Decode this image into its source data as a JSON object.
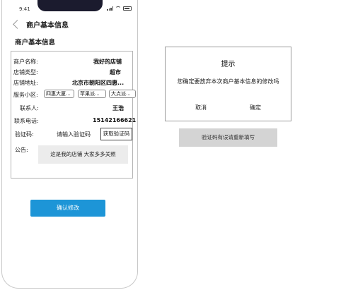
{
  "status_bar": {
    "time": "9:41"
  },
  "header": {
    "title": "商户基本信息"
  },
  "section": {
    "title": "商户基本信息"
  },
  "form": {
    "merchant_name_label": "商户名称:",
    "merchant_name_value": "我好的店铺",
    "store_type_label": "店铺类型:",
    "store_type_value": "超市",
    "store_address_label": "店铺地址:",
    "store_address_value": "北京市朝阳区四惠...",
    "service_area_label": "服务小区:",
    "service_areas": [
      "四惠大厦...",
      "苹果派...",
      "大点派..."
    ],
    "contact_label": "联系人:",
    "contact_value": "王浩",
    "phone_label": "联系电话:",
    "phone_value": "15142166621",
    "code_label": "验证码:",
    "code_placeholder": "请输入验证码",
    "get_code_button": "获取验证码",
    "notice_label": "公告:",
    "notice_value": "这是我的店铺 大家多多关照"
  },
  "confirm_button": "确认修改",
  "dialog": {
    "title": "提示",
    "message": "您确定要放弃本次商户基本信息的修改吗",
    "cancel": "取消",
    "ok": "确定"
  },
  "toast": {
    "message": "验证码有误请重新填写"
  }
}
